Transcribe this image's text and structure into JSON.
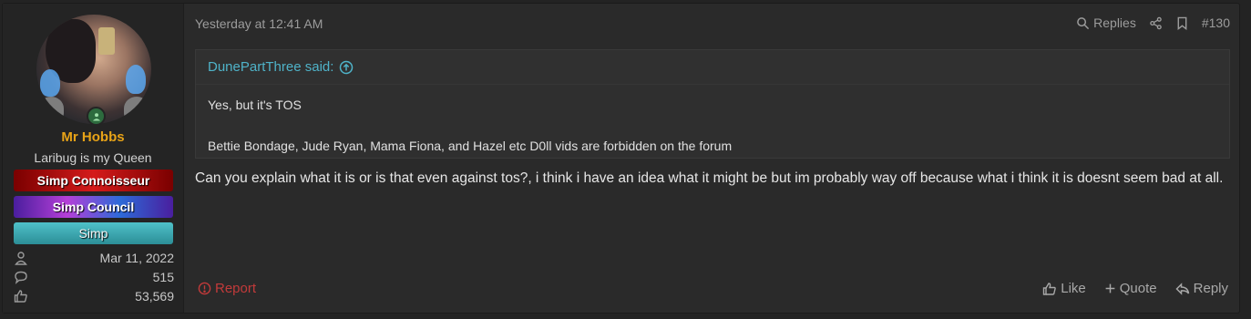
{
  "user": {
    "name": "Mr Hobbs",
    "title": "Laribug is my Queen",
    "banners": [
      "Simp Connoisseur",
      "Simp Council",
      "Simp"
    ],
    "joined": "Mar 11, 2022",
    "messages": "515",
    "reactions": "53,569",
    "status_color": "#2d6b3e"
  },
  "post": {
    "timestamp": "Yesterday at 12:41 AM",
    "actions": {
      "replies": "Replies",
      "number": "#130"
    },
    "quote": {
      "author": "DunePartThree said:",
      "lines": [
        "Yes, but it's TOS",
        "Bettie Bondage, Jude Ryan, Mama Fiona, and Hazel etc D0ll vids are forbidden on the forum"
      ]
    },
    "message": "Can you explain what it is or is that even against tos?, i think i have an idea what it might be but im probably way off because what i think it is doesnt seem bad at all.",
    "report": "Report",
    "footer": {
      "like": "Like",
      "quote": "Quote",
      "reply": "Reply"
    }
  },
  "colors": {
    "username": "#e8a317",
    "quote_author": "#4fb3c9",
    "report": "#c23a3a"
  }
}
